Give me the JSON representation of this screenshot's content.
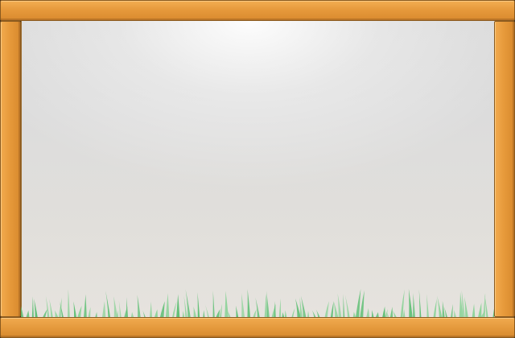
{
  "scene": {
    "type": "empty-game-playfield",
    "frame_material": "wood",
    "ground": "grass"
  },
  "colors": {
    "frame_light": "#f3ae52",
    "frame_mid": "#e79a3c",
    "frame_dark": "#d98a2e",
    "frame_edge": "#8a5a1f",
    "sky_top": "#d9d9d9",
    "sky_bottom": "#e6e3de",
    "grass_light": "#8fd39b",
    "grass_dark": "#5fbf75"
  },
  "icons": {
    "grass": "grass-blades-decoration"
  }
}
